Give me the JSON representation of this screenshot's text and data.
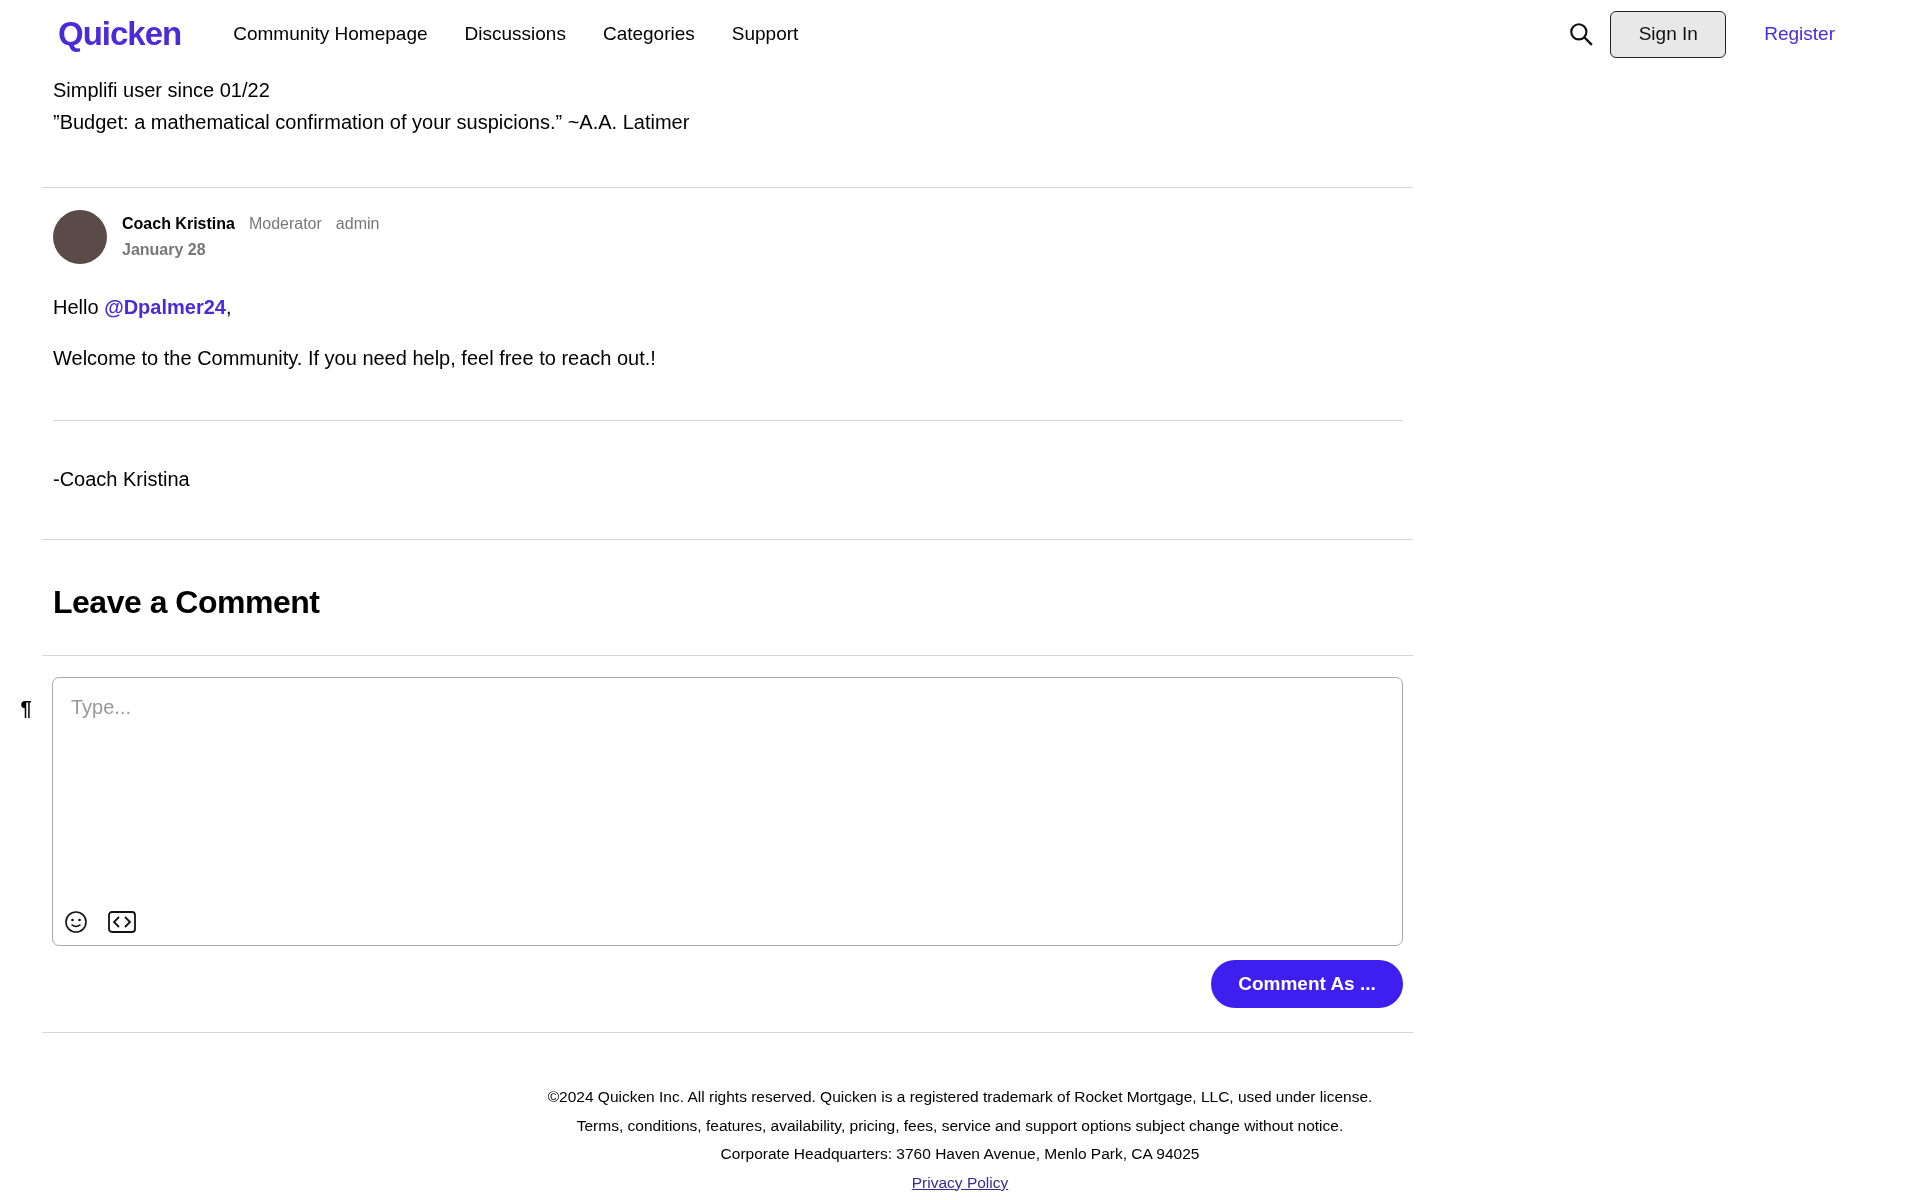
{
  "header": {
    "logo": "Quicken",
    "nav": [
      {
        "label": "Community Homepage"
      },
      {
        "label": "Discussions"
      },
      {
        "label": "Categories"
      },
      {
        "label": "Support"
      }
    ],
    "sign_in": "Sign In",
    "register": "Register"
  },
  "previous_signature": [
    "Simplifi user since 01/22",
    "”Budget: a mathematical confirmation of your suspicions.” ~A.A. Latimer"
  ],
  "comment": {
    "author": "Coach Kristina",
    "role": "Moderator",
    "rank": "admin",
    "date": "January 28",
    "greeting": {
      "before": "Hello",
      "mention": "@Dpalmer24",
      "after": ","
    },
    "body": "Welcome to the Community. If you need help, feel free to reach out.!",
    "signature": "-Coach Kristina"
  },
  "leave_comment": {
    "title": "Leave a Comment",
    "format_mark": "¶",
    "placeholder": "Type...",
    "submit": "Comment As ..."
  },
  "footer": {
    "lines": [
      "©2024 Quicken Inc. All rights reserved. Quicken is a registered trademark of Rocket Mortgage, LLC, used under license.",
      "Terms, conditions, features, availability, pricing, fees, service and support options subject change without notice.",
      "Corporate Headquarters: 3760 Haven Avenue, Menlo Park, CA 94025"
    ],
    "privacy_link": "Privacy Policy"
  }
}
